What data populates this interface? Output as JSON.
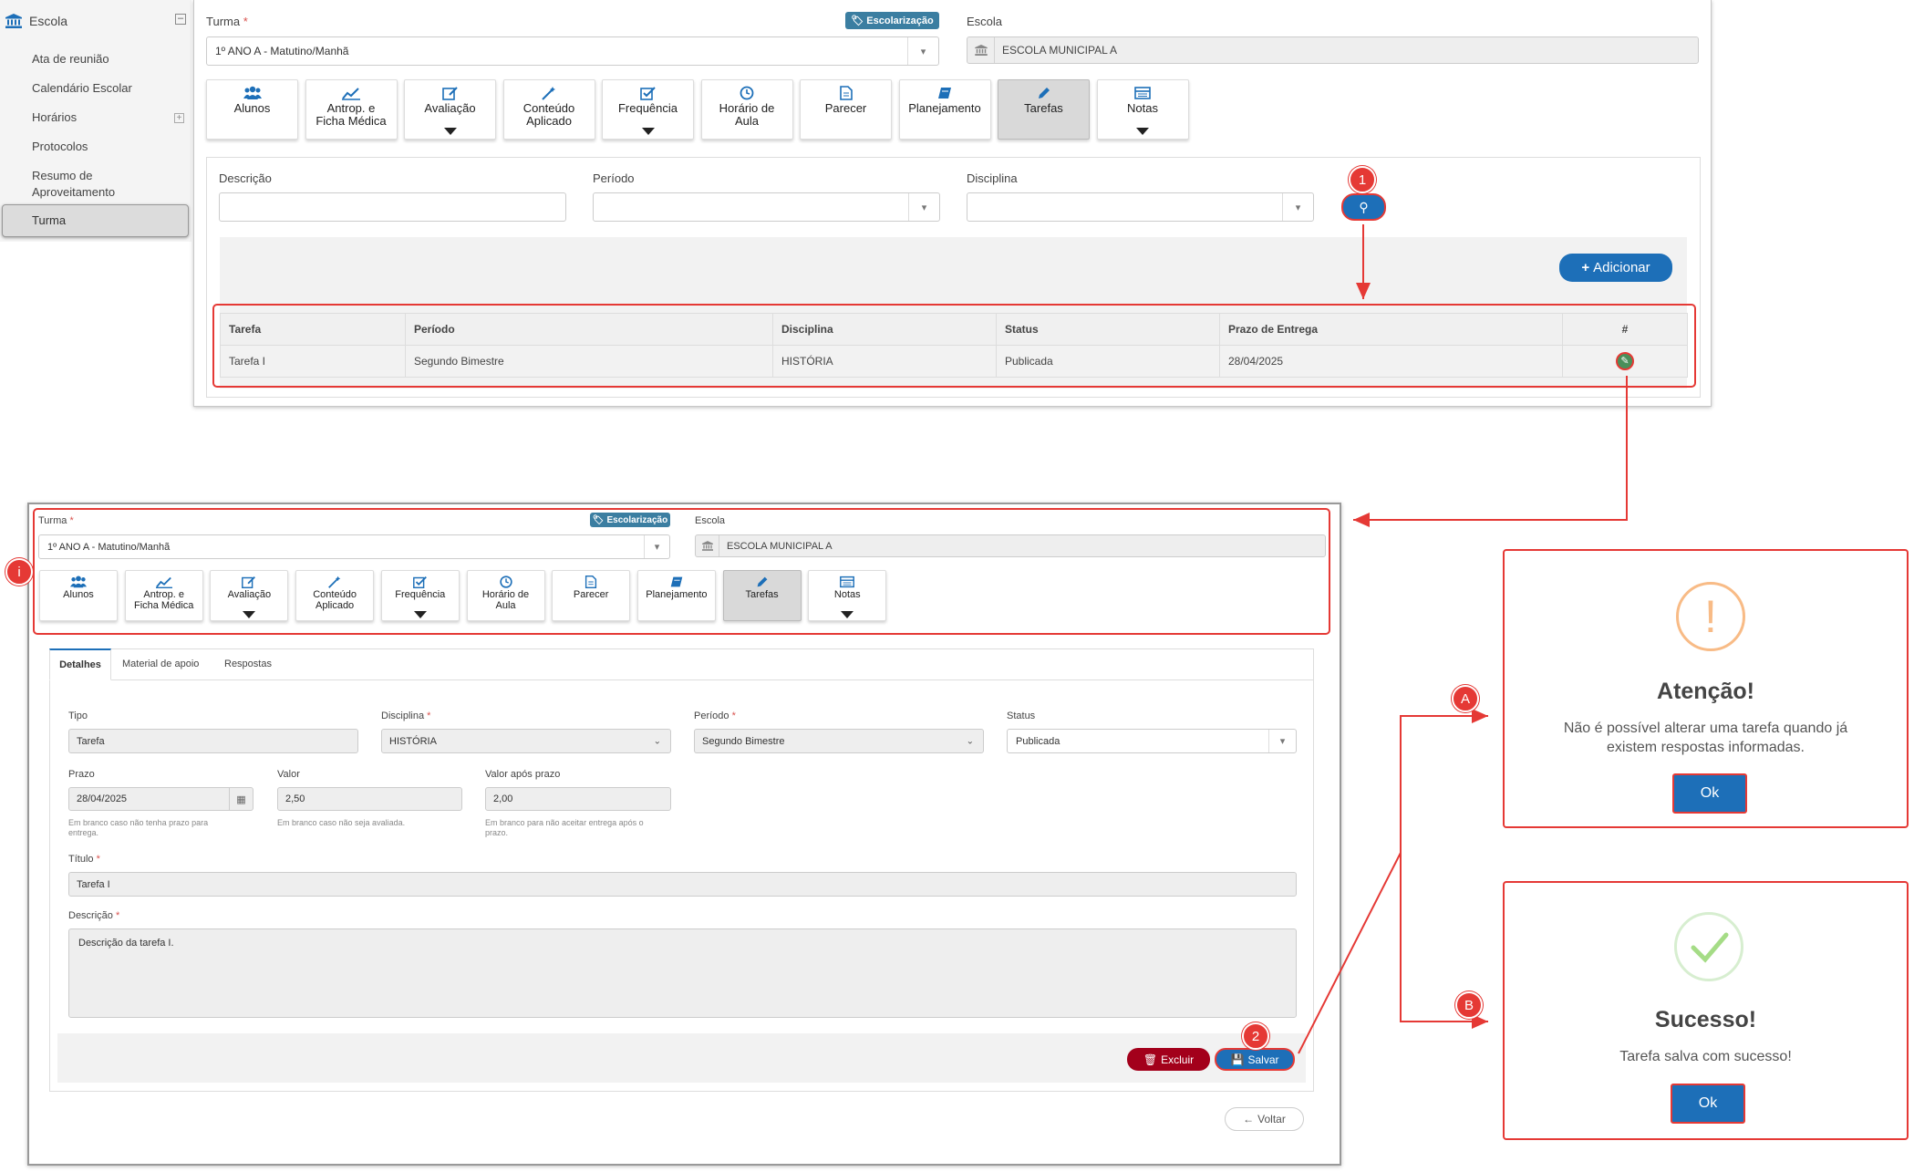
{
  "sidebar": {
    "title": "Escola",
    "items": [
      {
        "label": "Ata de reunião"
      },
      {
        "label": "Calendário Escolar"
      },
      {
        "label": "Horários"
      },
      {
        "label": "Protocolos"
      },
      {
        "label": "Resumo de"
      },
      {
        "label": "Aproveitamento"
      },
      {
        "label": "Turma"
      }
    ]
  },
  "top": {
    "turma_label": "Turma",
    "turma_value": "1º ANO A - Matutino/Manhã",
    "badge": "Escolarização",
    "escola_label": "Escola",
    "escola_value": "ESCOLA MUNICIPAL A",
    "tabs": [
      {
        "line1": "Alunos",
        "line2": ""
      },
      {
        "line1": "Antrop. e",
        "line2": "Ficha Médica"
      },
      {
        "line1": "Avaliação",
        "line2": ""
      },
      {
        "line1": "Conteúdo",
        "line2": "Aplicado"
      },
      {
        "line1": "Frequência",
        "line2": ""
      },
      {
        "line1": "Horário de",
        "line2": "Aula"
      },
      {
        "line1": "Parecer",
        "line2": ""
      },
      {
        "line1": "Planejamento",
        "line2": ""
      },
      {
        "line1": "Tarefas",
        "line2": ""
      },
      {
        "line1": "Notas",
        "line2": ""
      }
    ],
    "filters": {
      "descricao_label": "Descrição",
      "periodo_label": "Período",
      "disciplina_label": "Disciplina"
    },
    "add_button": "Adicionar",
    "table": {
      "headers": [
        "Tarefa",
        "Período",
        "Disciplina",
        "Status",
        "Prazo de Entrega",
        "#"
      ],
      "rows": [
        [
          "Tarefa I",
          "Segundo Bimestre",
          "HISTÓRIA",
          "Publicada",
          "28/04/2025"
        ]
      ]
    }
  },
  "markers": {
    "one": "1",
    "two": "2",
    "i": "i",
    "a": "A",
    "b": "B"
  },
  "detail": {
    "turma_label": "Turma",
    "turma_value": "1º ANO A - Matutino/Manhã",
    "badge": "Escolarização",
    "escola_label": "Escola",
    "escola_value": "ESCOLA MUNICIPAL A",
    "subtabs": [
      "Detalhes",
      "Material de apoio",
      "Respostas"
    ],
    "tipo_label": "Tipo",
    "tipo_value": "Tarefa",
    "disciplina_label": "Disciplina",
    "disciplina_value": "HISTÓRIA",
    "periodo_label": "Período",
    "periodo_value": "Segundo Bimestre",
    "status_label": "Status",
    "status_value": "Publicada",
    "prazo_label": "Prazo",
    "prazo_value": "28/04/2025",
    "prazo_help_1": "Em branco caso não tenha prazo para",
    "prazo_help_2": "entrega.",
    "valor_label": "Valor",
    "valor_value": "2,50",
    "valor_help": "Em branco caso não seja avaliada.",
    "valor_apos_label": "Valor após prazo",
    "valor_apos_value": "2,00",
    "valor_apos_help_1": "Em branco para não aceitar entrega após o",
    "valor_apos_help_2": "prazo.",
    "titulo_label": "Título",
    "titulo_value": "Tarefa I",
    "descricao_label": "Descrição",
    "descricao_value": "Descrição da tarefa I.",
    "excluir": "Excluir",
    "salvar": "Salvar",
    "voltar": "Voltar"
  },
  "modal_warning": {
    "title": "Atenção!",
    "msg_1": "Não é possível alterar uma tarefa quando já",
    "msg_2": "existem respostas informadas.",
    "ok": "Ok"
  },
  "modal_success": {
    "title": "Sucesso!",
    "msg": "Tarefa salva com sucesso!",
    "ok": "Ok"
  },
  "colors": {
    "accent": "#1d6fb8",
    "danger": "#a3001b",
    "annotation": "#e53935"
  }
}
